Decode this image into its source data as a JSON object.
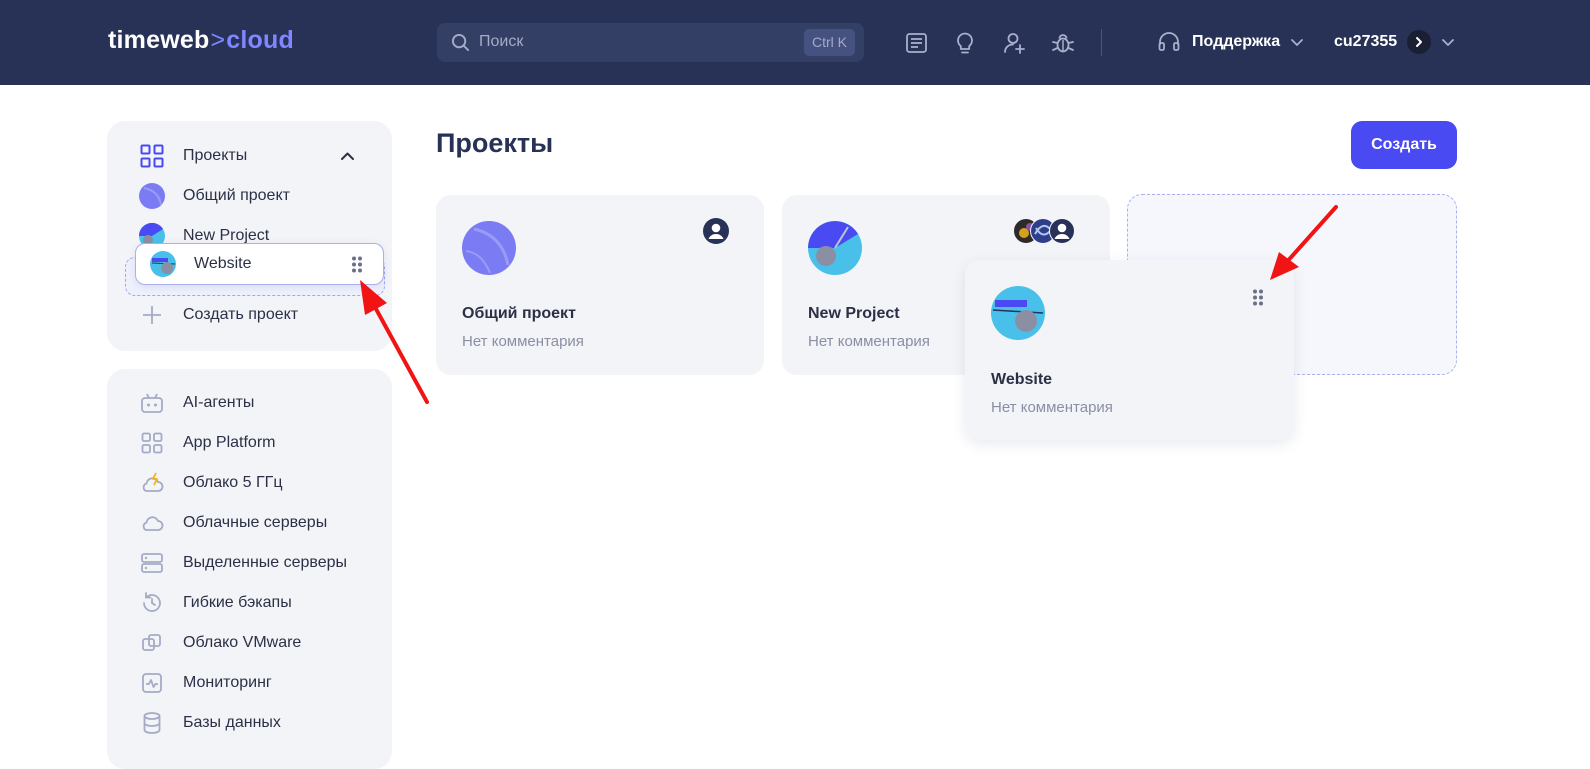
{
  "header": {
    "logo_main": "timeweb",
    "logo_sep": ">",
    "logo_accent": "cloud",
    "search_placeholder": "Поиск",
    "search_shortcut": "Ctrl K",
    "icons": [
      "docs-icon",
      "lightbulb-icon",
      "add-user-icon",
      "bug-icon"
    ],
    "support_label": "Поддержка",
    "account_name": "cu27355"
  },
  "sidebar": {
    "projects_title": "Проекты",
    "projects": [
      {
        "label": "Общий проект"
      },
      {
        "label": "New Project"
      }
    ],
    "dragging_item": "Website",
    "create_project_label": "Создать проект",
    "services": [
      {
        "label": "AI-агенты",
        "icon": "robot-icon"
      },
      {
        "label": "App Platform",
        "icon": "grid-icon"
      },
      {
        "label": "Облако 5 ГГц",
        "icon": "cloud-bolt-icon"
      },
      {
        "label": "Облачные серверы",
        "icon": "cloud-icon"
      },
      {
        "label": "Выделенные серверы",
        "icon": "server-icon"
      },
      {
        "label": "Гибкие бэкапы",
        "icon": "backup-icon"
      },
      {
        "label": "Облако VMware",
        "icon": "vmware-icon"
      },
      {
        "label": "Мониторинг",
        "icon": "monitoring-icon"
      },
      {
        "label": "Базы данных",
        "icon": "database-icon"
      }
    ]
  },
  "main": {
    "title": "Проекты",
    "create_button": "Создать",
    "cards": [
      {
        "name": "Общий проект",
        "comment": "Нет комментария"
      },
      {
        "name": "New Project",
        "comment": "Нет комментария"
      }
    ],
    "dragged_card": {
      "name": "Website",
      "comment": "Нет комментария"
    }
  },
  "colors": {
    "header_bg": "#283256",
    "accent": "#4a4af2",
    "card_bg": "#f3f4f7",
    "annotation_arrow": "#f01414"
  }
}
